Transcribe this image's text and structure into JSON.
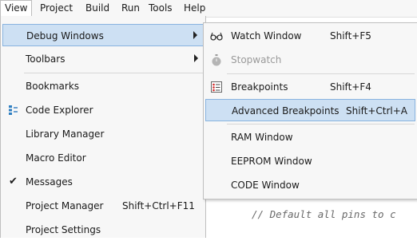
{
  "menubar": {
    "view": "View",
    "project": "Project",
    "build": "Build",
    "run": "Run",
    "tools": "Tools",
    "help": "Help"
  },
  "view_menu": {
    "debug_windows": "Debug Windows",
    "toolbars": "Toolbars",
    "bookmarks": "Bookmarks",
    "code_explorer": "Code Explorer",
    "library_manager": "Library Manager",
    "macro_editor": "Macro Editor",
    "messages": "Messages",
    "project_manager": "Project Manager",
    "project_manager_shortcut": "Shift+Ctrl+F11",
    "project_settings": "Project Settings"
  },
  "debug_submenu": {
    "watch_window": "Watch Window",
    "watch_window_shortcut": "Shift+F5",
    "stopwatch": "Stopwatch",
    "breakpoints": "Breakpoints",
    "breakpoints_shortcut": "Shift+F4",
    "advanced_breakpoints": "Advanced Breakpoints",
    "advanced_breakpoints_shortcut": "Shift+Ctrl+A",
    "ram_window": "RAM Window",
    "eeprom_window": "EEPROM Window",
    "code_window": "CODE Window"
  },
  "editor": {
    "code_line": "// Default all pins to c"
  },
  "colors": {
    "highlight_fill": "#cde0f3",
    "highlight_border": "#88b3df",
    "menu_bg": "#f7f7f7",
    "disabled_text": "#9a9a9a",
    "comment_text": "#6a6a6a"
  },
  "icons": {
    "watch_window": "glasses-icon",
    "stopwatch": "stopwatch-icon",
    "breakpoints": "breakpoints-list-icon",
    "code_explorer": "tree-icon",
    "messages": "checkmark-icon"
  }
}
